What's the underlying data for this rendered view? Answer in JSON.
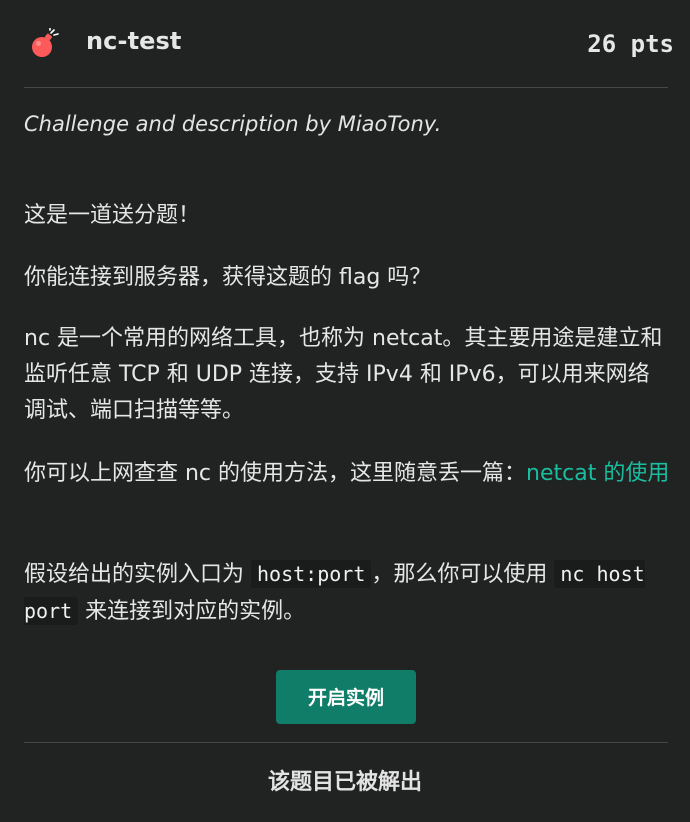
{
  "challenge": {
    "title": "nc-test",
    "points": "26 pts",
    "icon": "bomb-icon",
    "accent_color": "#1bbd9f",
    "button_color": "#0f7d67",
    "icon_color": "#ff5a5a"
  },
  "description": {
    "author_line": "Challenge and description by MiaoTony.",
    "p1": "这是一道送分题！",
    "p2": "你能连接到服务器，获得这题的 flag 吗？",
    "p3": "nc 是一个常用的网络工具，也称为 netcat。其主要用途是建立和监听任意 TCP 和 UDP 连接，支持 IPv4 和 IPv6，可以用来网络调试、端口扫描等等。",
    "p4_text": "你可以上网查查 nc 的使用方法，这里随意丢一篇：",
    "p4_link": "netcat 的使用",
    "p5_part1": "假设给出的实例入口为 ",
    "p5_code1": "host:port",
    "p5_part2": "，那么你可以使用 ",
    "p5_code2": "nc host port",
    "p5_part3": " 来连接到对应的实例。"
  },
  "actions": {
    "start_instance": "开启实例",
    "solved_status": "该题目已被解出"
  }
}
